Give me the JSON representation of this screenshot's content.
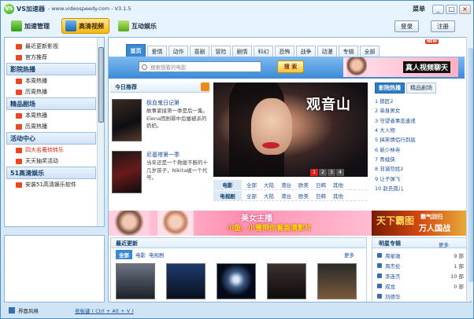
{
  "window": {
    "app_title": "VS加速器",
    "url_version": "- www.videospeedy.com - V3.1.5",
    "menu_label": "菜单",
    "minimize": "_",
    "maximize": "□",
    "close": "×"
  },
  "toolbar": {
    "buttons": [
      "加速管理",
      "高清视频",
      "互动娱乐"
    ],
    "active": "高清视频",
    "login": "登录",
    "register": "注册"
  },
  "sidebar": {
    "groups": [
      {
        "title": "",
        "items": [
          "最近更新影视",
          "官方推荐"
        ]
      },
      {
        "title": "影院热播",
        "items": [
          "本周热播",
          "历周热播"
        ]
      },
      {
        "title": "精品剧场",
        "items": [
          "本周热播",
          "历周热播"
        ]
      },
      {
        "title": "活动中心",
        "items": [
          "四大名著转转乐",
          "天天抽奖活动"
        ]
      },
      {
        "title": "51高清娱乐",
        "items": [
          "安装51高清娱乐软件"
        ]
      }
    ]
  },
  "nav": {
    "tabs": [
      "首页",
      "爱情",
      "动作",
      "喜剧",
      "冒险",
      "剧情",
      "科幻",
      "恐怖",
      "战争",
      "动漫",
      "专辑",
      "全部"
    ],
    "active": "首页",
    "new_badge": "NEW"
  },
  "search": {
    "placeholder": "搜索想看的电影",
    "button": "搜 索"
  },
  "top_banner": {
    "text": "真人视频聊天"
  },
  "today": {
    "title": "今日推荐",
    "items": [
      {
        "title": "极血鬼日记第",
        "desc": "故事紧接第一季是后一集。Elena因剧罪中后屡被杀的奶奶。"
      },
      {
        "title": "尼基塔第一季",
        "desc": "当年还是一个救援不断的十几岁孩子，Nikita被一个代号。"
      }
    ]
  },
  "hero": {
    "title": "观音山",
    "pages": [
      "1",
      "2",
      "3",
      "4"
    ],
    "current_page": "1"
  },
  "categories": [
    {
      "label": "电影",
      "items": [
        "全部",
        "大陆",
        "港台",
        "欧美",
        "日韩",
        "其他"
      ]
    },
    {
      "label": "电视剧",
      "items": [
        "全部",
        "大陆",
        "港台",
        "欧美",
        "日韩",
        "其他"
      ]
    }
  ],
  "ranking": {
    "tabs": [
      "影院热播",
      "精品剧场"
    ],
    "active": "影院热播",
    "items": [
      "1 锁匠2",
      "2 单身男女",
      "3 守望者事态速递",
      "4 大人物",
      "5 搞笑情侣行到底",
      "6 新少林寺",
      "7 青蛙侠",
      "8 非诚勿扰2",
      "9 让子弹飞",
      "10 赵氏孤儿"
    ]
  },
  "mid_banner": {
    "line1": "美女主播",
    "line2": "小鱼、小雪带你看高清影片",
    "right_logo": "天下霸图",
    "right_line1": "霸气回归",
    "right_line2": "万人国战"
  },
  "latest": {
    "title": "最近更新",
    "tabs": [
      "全部",
      "电影",
      "电视剧"
    ],
    "more": "更多"
  },
  "stars": {
    "title": "明星专辑",
    "more": "更多",
    "list": [
      {
        "name": "周星驰",
        "count": "9 部"
      },
      {
        "name": "周杰伦",
        "count": "1 部"
      },
      {
        "name": "李连杰",
        "count": "10 部"
      },
      {
        "name": "成龙",
        "count": "0 部"
      },
      {
        "name": "刘德华",
        "count": ""
      }
    ]
  },
  "status": {
    "theme": "界面风格",
    "hotkey": "老板键 ( Ctrl + Alt + V )"
  }
}
